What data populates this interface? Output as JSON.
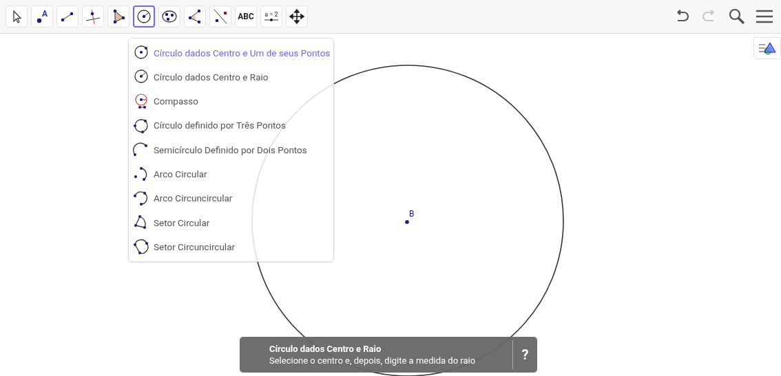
{
  "toolbar": {
    "tools": [
      {
        "kind": "move",
        "selected": false
      },
      {
        "kind": "point",
        "label": "A",
        "selected": false
      },
      {
        "kind": "segment",
        "selected": false
      },
      {
        "kind": "perpendicular",
        "selected": false
      },
      {
        "kind": "polygon",
        "selected": false
      },
      {
        "kind": "circle",
        "selected": true
      },
      {
        "kind": "ellipse",
        "selected": false
      },
      {
        "kind": "angle",
        "selected": false
      },
      {
        "kind": "reflect",
        "selected": false
      },
      {
        "kind": "text",
        "label": "ABC",
        "selected": false
      },
      {
        "kind": "slider",
        "label": "a = 2",
        "selected": false
      },
      {
        "kind": "move-view",
        "selected": false
      }
    ],
    "undo": {
      "disabled": false
    },
    "redo": {
      "disabled": true
    }
  },
  "menu": {
    "items": [
      {
        "kind": "circle-point",
        "label": "Círculo dados Centro e Um de seus Pontos",
        "selected": true
      },
      {
        "kind": "circle-radius",
        "label": "Círculo dados Centro e Raio",
        "selected": false
      },
      {
        "kind": "compass",
        "label": "Compasso",
        "selected": false
      },
      {
        "kind": "circle-three",
        "label": "Círculo definido por Três Pontos",
        "selected": false
      },
      {
        "kind": "semicircle",
        "label": "Semicírculo Definido por Dois Pontos",
        "selected": false
      },
      {
        "kind": "arc",
        "label": "Arco Circular",
        "selected": false
      },
      {
        "kind": "circumarc",
        "label": "Arco Circuncircular",
        "selected": false
      },
      {
        "kind": "sector",
        "label": "Setor Circular",
        "selected": false
      },
      {
        "kind": "circumsector",
        "label": "Setor Circuncircular",
        "selected": false
      }
    ]
  },
  "canvas": {
    "point_label": "B"
  },
  "tooltip": {
    "title": "Círculo dados Centro e Raio",
    "text": "Selecione o centro e, depois, digite a medida do raio",
    "help": "?"
  }
}
